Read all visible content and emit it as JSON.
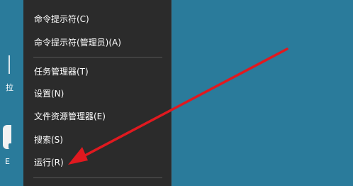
{
  "menu": {
    "items": [
      {
        "label": "命令提示符(C)"
      },
      {
        "label": "命令提示符(管理员)(A)"
      },
      {
        "label": "任务管理器(T)"
      },
      {
        "label": "设置(N)"
      },
      {
        "label": "文件资源管理器(E)"
      },
      {
        "label": "搜索(S)"
      },
      {
        "label": "运行(R)"
      }
    ]
  },
  "desktop": {
    "left_text_1": "拉",
    "left_text_2": "E"
  },
  "annotation": {
    "arrow_color": "#e0191f"
  },
  "colors": {
    "desktop_background": "#2a7b9b",
    "menu_background": "#2b2b2b",
    "separator": "#555555"
  }
}
